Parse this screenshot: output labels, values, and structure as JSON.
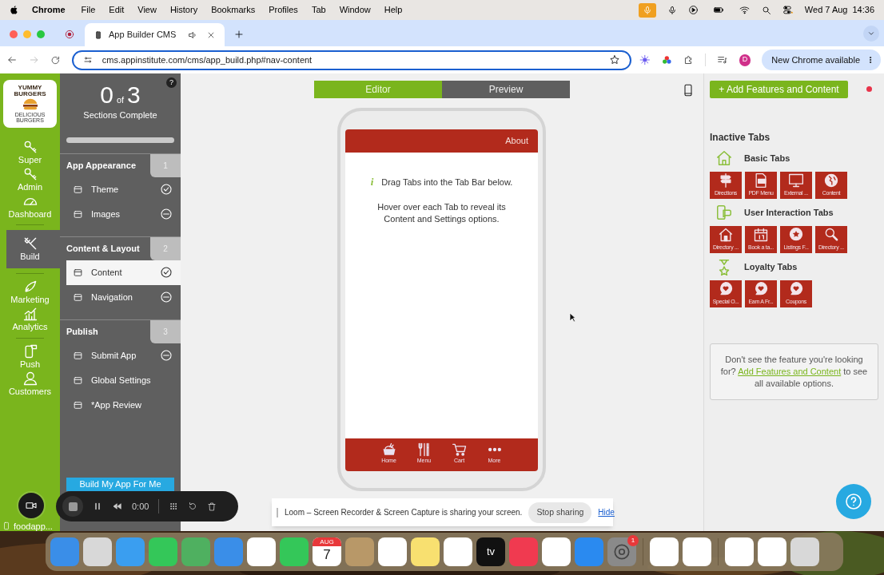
{
  "menu_bar": {
    "app": "Chrome",
    "items": [
      "File",
      "Edit",
      "View",
      "History",
      "Bookmarks",
      "Profiles",
      "Tab",
      "Window",
      "Help"
    ],
    "date": "Wed 7 Aug",
    "time": "14:36"
  },
  "browser": {
    "tab_title": "App Builder CMS",
    "url": "cms.appinstitute.com/cms/app_build.php#nav-content",
    "avatar": "D",
    "update": "New Chrome available"
  },
  "logo": {
    "title": "YUMMY BURGERS",
    "subtitle": "DELICIOUS BURGERS"
  },
  "nav_rail": [
    {
      "label": "Super",
      "selected": false
    },
    {
      "label": "Admin",
      "selected": false
    },
    {
      "label": "Dashboard",
      "selected": false
    },
    {
      "label": "Build",
      "selected": true
    },
    {
      "label": "Marketing",
      "selected": false
    },
    {
      "label": "Analytics",
      "selected": false
    },
    {
      "label": "Push",
      "selected": false
    },
    {
      "label": "Customers",
      "selected": false
    }
  ],
  "project": "foodapp...",
  "progress": {
    "help": "?",
    "done": "0",
    "of": "of",
    "total": "3",
    "label": "Sections Complete",
    "level": 0
  },
  "sections": [
    {
      "title": "App Appearance",
      "number": "1",
      "items": [
        {
          "label": "Theme",
          "complete": true,
          "selected": false
        },
        {
          "label": "Images",
          "complete": false,
          "selected": false
        }
      ]
    },
    {
      "title": "Content & Layout",
      "number": "2",
      "items": [
        {
          "label": "Content",
          "complete": true,
          "selected": true
        },
        {
          "label": "Navigation",
          "complete": false,
          "selected": false
        }
      ]
    },
    {
      "title": "Publish",
      "number": "3",
      "items": [
        {
          "label": "Submit App",
          "complete": false,
          "selected": false
        },
        {
          "label": "Global Settings",
          "selected": false
        },
        {
          "label": "*App Review",
          "selected": false
        }
      ]
    }
  ],
  "build_button": "Build My App For Me",
  "editor_tabs": [
    {
      "label": "Editor",
      "selected": true
    },
    {
      "label": "Preview",
      "selected": false
    }
  ],
  "phone": {
    "header": "About",
    "info_icon": "i",
    "info": "Drag Tabs into the Tab Bar below.",
    "hint": "Hover over each Tab to reveal its Content and Settings options.",
    "tab_bar": [
      "Home",
      "Menu",
      "Cart",
      "More"
    ]
  },
  "add_button": "+ Add Features and Content",
  "inactive_heading": "Inactive Tabs",
  "tab_groups": [
    {
      "title": "Basic Tabs",
      "tiles": [
        "Directions",
        "PDF Menu",
        "External ...",
        "Content"
      ]
    },
    {
      "title": "User Interaction Tabs",
      "tiles": [
        "Directory ...",
        "Book a ta...",
        "Listings F...",
        "Directory ..."
      ]
    },
    {
      "title": "Loyalty Tabs",
      "tiles": [
        "Special O...",
        "Earn A Fr...",
        "Coupons"
      ]
    }
  ],
  "help_box": {
    "before": "Don't see the feature you're looking for?",
    "link": "Add Features and Content",
    "after": "to see all available options."
  },
  "loom": {
    "time": "0:00",
    "message": "Loom – Screen Recorder & Screen Capture is sharing your screen.",
    "stop": "Stop sharing",
    "hide": "Hide"
  },
  "dock": {
    "calendar_month": "AUG",
    "calendar_day": "7",
    "tv_label": "tv",
    "badge": "1"
  }
}
